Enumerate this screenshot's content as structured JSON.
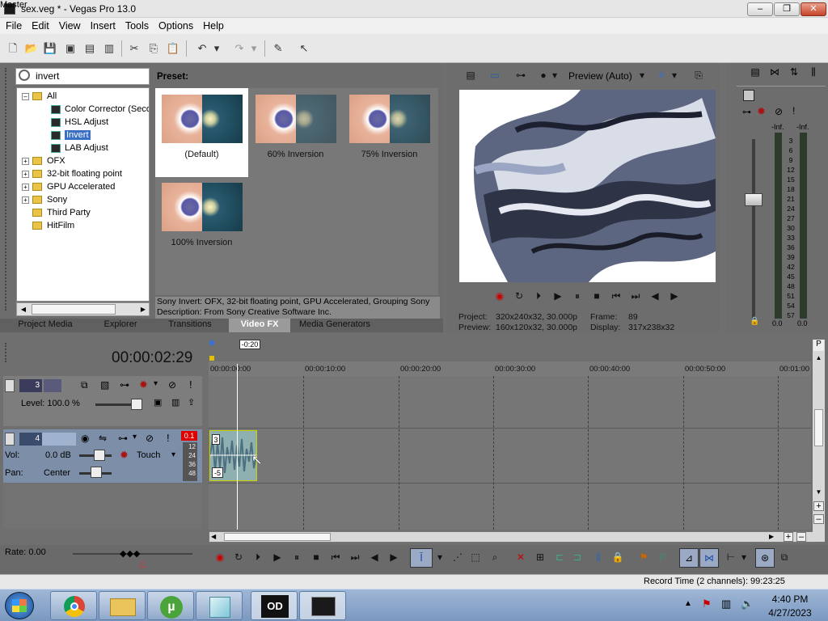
{
  "window": {
    "title": "sex.veg * - Vegas Pro 13.0",
    "minimize": "–",
    "maximize": "❐",
    "close": "✕"
  },
  "menu": [
    "File",
    "Edit",
    "View",
    "Insert",
    "Tools",
    "Options",
    "Help"
  ],
  "fx_browser": {
    "search_value": "invert",
    "tree": [
      {
        "label": "All",
        "type": "folder",
        "level": 0,
        "expander": "–"
      },
      {
        "label": "Color Corrector (Secondary)",
        "type": "fx",
        "level": 1
      },
      {
        "label": "HSL Adjust",
        "type": "fx",
        "level": 1
      },
      {
        "label": "Invert",
        "type": "fx",
        "level": 1,
        "selected": true
      },
      {
        "label": "LAB Adjust",
        "type": "fx",
        "level": 1
      },
      {
        "label": "OFX",
        "type": "folder",
        "level": 0,
        "expander": "+"
      },
      {
        "label": "32-bit floating point",
        "type": "folder",
        "level": 0,
        "expander": "+"
      },
      {
        "label": "GPU Accelerated",
        "type": "folder",
        "level": 0,
        "expander": "+"
      },
      {
        "label": "Sony",
        "type": "folder",
        "level": 0,
        "expander": "+"
      },
      {
        "label": "Third Party",
        "type": "folder",
        "level": 0,
        "expander": ""
      },
      {
        "label": "HitFilm",
        "type": "folder",
        "level": 0,
        "expander": ""
      }
    ],
    "preset_heading": "Preset:",
    "presets": [
      {
        "label": "(Default)",
        "selected": true
      },
      {
        "label": "60% Inversion"
      },
      {
        "label": "75% Inversion"
      },
      {
        "label": "100% Inversion"
      }
    ],
    "description_line1": "Sony Invert: OFX, 32-bit floating point, GPU Accelerated, Grouping Sony",
    "description_line2": "Description: From Sony Creative Software Inc."
  },
  "tabs": [
    {
      "label": "Project Media"
    },
    {
      "label": "Explorer"
    },
    {
      "label": "Transitions"
    },
    {
      "label": "Video FX",
      "active": true
    },
    {
      "label": "Media Generators"
    }
  ],
  "preview": {
    "mode": "Preview (Auto)",
    "project_label": "Project:",
    "project_value": "320x240x32, 30.000p",
    "frame_label": "Frame:",
    "frame_value": "89",
    "preview_label": "Preview:",
    "preview_value": "160x120x32, 30.000p",
    "display_label": "Display:",
    "display_value": "317x238x32"
  },
  "mixer": {
    "title": "Master",
    "inf_left": "-Inf.",
    "inf_right": "-Inf.",
    "scale": [
      "3",
      "6",
      "9",
      "12",
      "15",
      "18",
      "21",
      "24",
      "27",
      "30",
      "33",
      "36",
      "39",
      "42",
      "45",
      "48",
      "51",
      "54",
      "57"
    ],
    "val_left": "0.0",
    "val_right": "0.0"
  },
  "timeline": {
    "timecode": "00:00:02:29",
    "cursor_label": "-0:20",
    "ruler": [
      "00:00:00:00",
      "00:00:10:00",
      "00:00:20:00",
      "00:00:30:00",
      "00:00:40:00",
      "00:00:50:00",
      "00:01:00"
    ],
    "video_track": {
      "number": "3",
      "level_label": "Level: 100.0 %"
    },
    "audio_track": {
      "number": "4",
      "vol_label": "Vol:",
      "vol_value": "0.0 dB",
      "pan_label": "Pan:",
      "pan_value": "Center",
      "mode": "Touch",
      "peak": "0.1",
      "meter": [
        "12",
        "24",
        "36",
        "48"
      ]
    },
    "clip": {
      "top_badge": "3",
      "bottom_badge": "-5"
    },
    "rate": "Rate: 0.00"
  },
  "status": {
    "record_time": "Record Time (2 channels): 99:23:25"
  },
  "taskbar": {
    "time": "4:40 PM",
    "date": "4/27/2023"
  }
}
